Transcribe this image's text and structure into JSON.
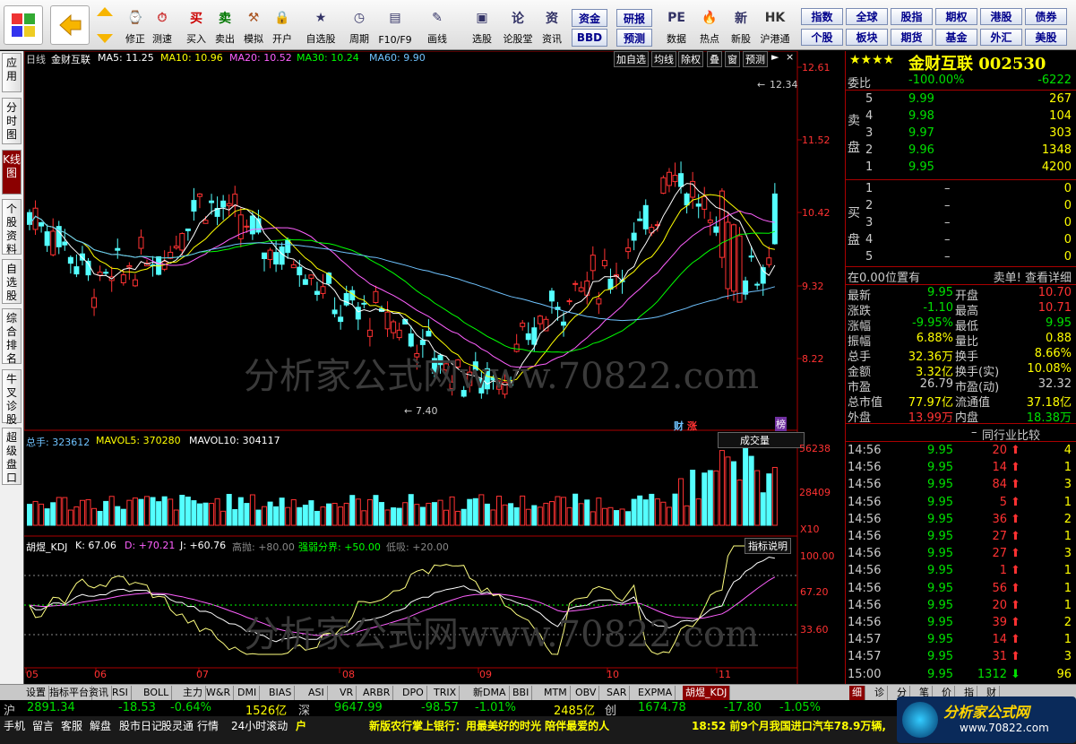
{
  "toolbar": {
    "left": [
      "修正",
      "测速",
      "买入",
      "卖出",
      "模拟",
      "开户",
      "自选股",
      "周期",
      "F10/F9",
      "画线",
      "选股",
      "论股堂",
      "资讯",
      "数据",
      "热点",
      "新股",
      "沪港通"
    ],
    "mid_buttons": [
      "资金",
      "研报",
      "BBD",
      "预测"
    ],
    "quick": [
      "指数",
      "全球",
      "股指",
      "期权",
      "港股",
      "债券",
      "个股",
      "板块",
      "期货",
      "基金",
      "外汇",
      "美股"
    ]
  },
  "side_tabs": [
    "应用",
    "分时图",
    "K线图",
    "个股资料",
    "自选股",
    "综合排名",
    "牛叉诊股",
    "超级盘口"
  ],
  "chart": {
    "period": "日线",
    "name": "金财互联",
    "ma": [
      {
        "label": "MA5: 11.25",
        "color": "#ffffff"
      },
      {
        "label": "MA10: 10.96",
        "color": "#ffff00"
      },
      {
        "label": "MA20: 10.52",
        "color": "#ff60ff"
      },
      {
        "label": "MA30: 10.24",
        "color": "#00ff00"
      },
      {
        "label": "MA60: 9.90",
        "color": "#6fc3ff"
      }
    ],
    "top_buttons": [
      "加自选",
      "均线",
      "除权",
      "叠",
      "窗",
      "预测"
    ],
    "price_axis": [
      "12.61",
      "11.52",
      "10.42",
      "9.32",
      "8.22"
    ],
    "high_mark": "12.34",
    "low_mark": "7.40",
    "markers": [
      "财",
      "涨",
      "榜"
    ],
    "watermark_text": "分析家公式网www.70822.com",
    "vol": {
      "label": "总手: 323612",
      "mavol5": "MAVOL5: 370280",
      "mavol10": "MAVOL10: 304117",
      "dropdown": "成交量",
      "axis": [
        "56238",
        "28409"
      ],
      "unit": "X10"
    },
    "kdj": {
      "name": "胡煜_KDJ",
      "k": "K: 67.06",
      "d": "D: +70.21",
      "j": "J: +60.76",
      "gao": "高抛: +80.00",
      "qr": "强弱分界: +50.00",
      "di": "低吸: +20.00",
      "btn": "指标说明",
      "axis": [
        "100.00",
        "67.20",
        "33.60"
      ]
    },
    "months": [
      "05",
      "06",
      "07",
      "08",
      "09",
      "10",
      "11"
    ]
  },
  "quote": {
    "title": "金财互联 002530",
    "stars": "★★★★",
    "webi_label": "委比",
    "webi": "-100.00%",
    "webi_n": "-6222",
    "sell_label": "卖盘",
    "buy_label": "买盘",
    "sells": [
      {
        "n": "5",
        "p": "9.99",
        "v": "267"
      },
      {
        "n": "4",
        "p": "9.98",
        "v": "104"
      },
      {
        "n": "3",
        "p": "9.97",
        "v": "303"
      },
      {
        "n": "2",
        "p": "9.96",
        "v": "1348"
      },
      {
        "n": "1",
        "p": "9.95",
        "v": "4200"
      }
    ],
    "buys": [
      {
        "n": "1",
        "p": "–",
        "v": "0"
      },
      {
        "n": "2",
        "p": "–",
        "v": "0"
      },
      {
        "n": "3",
        "p": "–",
        "v": "0"
      },
      {
        "n": "4",
        "p": "–",
        "v": "0"
      },
      {
        "n": "5",
        "p": "–",
        "v": "0"
      }
    ],
    "pos": "在0.00位置有",
    "pos_r": "卖单! 查看详细",
    "stats": [
      [
        "最新",
        "9.95",
        "开盘",
        "10.70"
      ],
      [
        "涨跌",
        "-1.10",
        "最高",
        "10.71"
      ],
      [
        "涨幅",
        "-9.95%",
        "最低",
        "9.95"
      ],
      [
        "振幅",
        "6.88%",
        "量比",
        "0.88"
      ],
      [
        "总手",
        "32.36万",
        "换手",
        "8.66%"
      ],
      [
        "金额",
        "3.32亿",
        "换手(实)",
        "10.08%"
      ],
      [
        "市盈",
        "26.79",
        "市盈(动)",
        "32.32"
      ],
      [
        "总市值",
        "77.97亿",
        "流通值",
        "37.18亿"
      ],
      [
        "外盘",
        "13.99万",
        "内盘",
        "18.38万"
      ]
    ],
    "compare": "同行业比较",
    "dash": "–",
    "ticks": [
      {
        "t": "14:56",
        "p": "9.95",
        "v": "20",
        "n": "4"
      },
      {
        "t": "14:56",
        "p": "9.95",
        "v": "14",
        "n": "1"
      },
      {
        "t": "14:56",
        "p": "9.95",
        "v": "84",
        "n": "3"
      },
      {
        "t": "14:56",
        "p": "9.95",
        "v": "5",
        "n": "1"
      },
      {
        "t": "14:56",
        "p": "9.95",
        "v": "36",
        "n": "2"
      },
      {
        "t": "14:56",
        "p": "9.95",
        "v": "27",
        "n": "1"
      },
      {
        "t": "14:56",
        "p": "9.95",
        "v": "27",
        "n": "3"
      },
      {
        "t": "14:56",
        "p": "9.95",
        "v": "1",
        "n": "1"
      },
      {
        "t": "14:56",
        "p": "9.95",
        "v": "56",
        "n": "1"
      },
      {
        "t": "14:56",
        "p": "9.95",
        "v": "20",
        "n": "1"
      },
      {
        "t": "14:56",
        "p": "9.95",
        "v": "39",
        "n": "2"
      },
      {
        "t": "14:57",
        "p": "9.95",
        "v": "14",
        "n": "1"
      },
      {
        "t": "14:57",
        "p": "9.95",
        "v": "31",
        "n": "3"
      },
      {
        "t": "15:00",
        "p": "9.95",
        "v": "1312",
        "n": "96"
      }
    ],
    "bottom_tabs": [
      "细",
      "诊",
      "分",
      "笔",
      "价",
      "指",
      "财"
    ]
  },
  "bottom_tabs": [
    "设置",
    "指标平台",
    "资讯",
    "RSI",
    "BOLL",
    "主力",
    "W&R",
    "DMI",
    "BIAS",
    "ASI",
    "VR",
    "ARBR",
    "DPO",
    "TRIX",
    "新DMA",
    "BBI",
    "MTM",
    "OBV",
    "SAR",
    "EXPMA",
    "胡煜_KDJ"
  ],
  "status": {
    "sh": "沪",
    "sh_idx": "2891.34",
    "sh_chg": "-18.53",
    "sh_pct": "-0.64%",
    "sh_amt": "1526亿",
    "sz": "深",
    "sz_idx": "9647.99",
    "sz_chg": "-98.57",
    "sz_pct": "-1.01%",
    "sz_amt": "2485亿",
    "cy": "创",
    "cy_idx": "1674.78",
    "cy_chg": "-17.80",
    "cy_pct": "-1.05%",
    "links": [
      "手机",
      "留言",
      "客服",
      "解盘",
      "股市日记",
      "股灵通",
      "行情",
      "24小时滚动"
    ],
    "hu": "户",
    "news": "新版农行掌上银行：用最美好的时光 陪伴最爱的人",
    "news2": "18:52 前9个月我国进口汽车78.9万辆,",
    "logo": "分析家公式网",
    "logo_url": "www.70822.com"
  }
}
